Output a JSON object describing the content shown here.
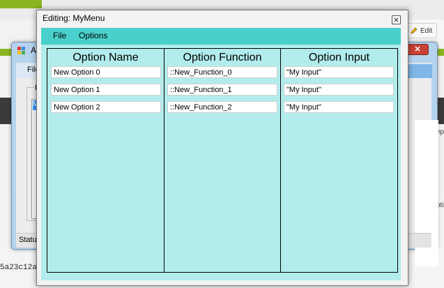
{
  "background": {
    "edit_button": "Edit",
    "code_fragment": "5a23c12a",
    "side_text_1": "ep",
    "side_text_2": "oti"
  },
  "back_window": {
    "title": "A",
    "menu_file": "File",
    "group_label": "E",
    "list_selected": "M",
    "status": "Status"
  },
  "dialog": {
    "title": "Editing: MyMenu",
    "menu": {
      "file": "File",
      "options": "Options"
    },
    "columns": [
      {
        "header": "Option Name",
        "cells": [
          "New Option 0",
          "New Option 1",
          "New Option 2"
        ]
      },
      {
        "header": "Option Function",
        "cells": [
          "::New_Function_0",
          "::New_Function_1",
          "::New_Function_2"
        ]
      },
      {
        "header": "Option Input",
        "cells": [
          "\"My Input\"",
          "\"My Input\"",
          "\"My Input\""
        ]
      }
    ]
  },
  "colors": {
    "menubar": "#4ad0cc",
    "content": "#b2ecec",
    "host_green": "#8ab520"
  }
}
